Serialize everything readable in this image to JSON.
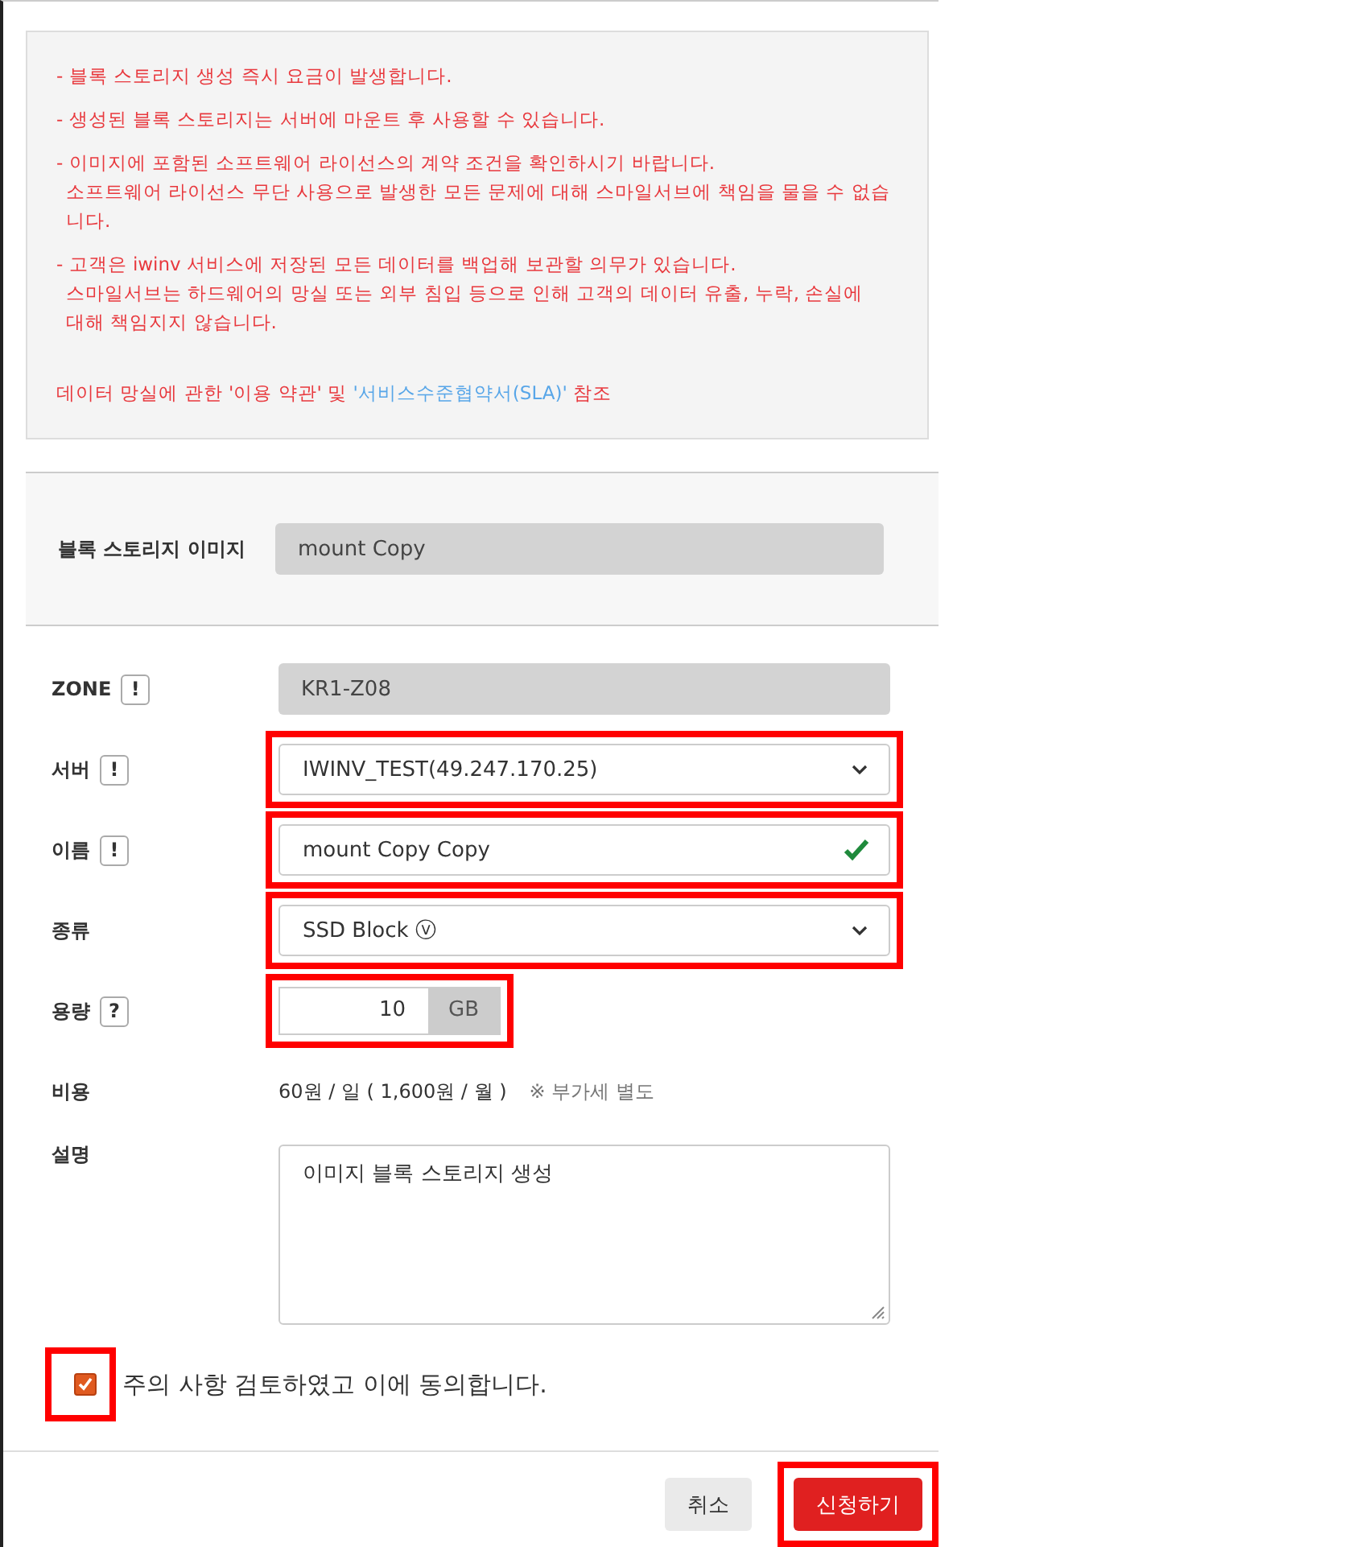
{
  "notice": {
    "paragraphs": [
      [
        "- 블록 스토리지 생성 즉시 요금이 발생합니다."
      ],
      [
        "- 생성된 블록 스토리지는 서버에 마운트 후 사용할 수 있습니다."
      ],
      [
        "- 이미지에 포함된 소프트웨어 라이선스의 계약 조건을 확인하시기 바랍니다.",
        "소프트웨어 라이선스 무단 사용으로 발생한 모든 문제에 대해 스마일서브에 책임을 물을 수 없습니다."
      ],
      [
        "- 고객은 iwinv 서비스에 저장된 모든 데이터를 백업해 보관할 의무가 있습니다.",
        "스마일서브는 하드웨어의 망실 또는 외부 침입 등으로 인해 고객의 데이터 유출, 누락, 손실에",
        "대해 책임지지 않습니다."
      ]
    ],
    "reference": {
      "before": "데이터 망실에 관한 '이용 약관' 및 ",
      "link": "'서비스수준협약서(SLA)'",
      "after": " 참조"
    }
  },
  "image": {
    "label": "블록 스토리지 이미지",
    "value": "mount Copy"
  },
  "fields": [
    {
      "kind": "readonly",
      "label": "ZONE",
      "hint": "!",
      "value": "KR1-Z08",
      "highlighted": false
    },
    {
      "kind": "select",
      "label": "서버",
      "hint": "!",
      "value": "IWINV_TEST(49.247.170.25)",
      "highlighted": true
    },
    {
      "kind": "text",
      "label": "이름",
      "hint": "!",
      "value": "mount Copy Copy",
      "valid": true,
      "highlighted": true
    },
    {
      "kind": "select",
      "label": "종류",
      "value": "SSD Block ⓥ",
      "highlighted": true
    },
    {
      "kind": "size",
      "label": "용량",
      "hint": "?",
      "value": "10",
      "unit": "GB",
      "highlighted": true
    },
    {
      "kind": "cost",
      "label": "비용",
      "value": "60원 / 일 ( 1,600원 / 월 )",
      "note": "※ 부가세 별도",
      "highlighted": false
    },
    {
      "kind": "textarea",
      "label": "설명",
      "value": "이미지 블록 스토리지 생성",
      "highlighted": false
    }
  ],
  "agree": {
    "label": "주의 사항 검토하였고 이에 동의합니다.",
    "checked": true,
    "highlighted": true
  },
  "buttons": [
    {
      "label": "취소",
      "kind": "secondary",
      "highlighted": false
    },
    {
      "label": "신청하기",
      "kind": "primary",
      "highlighted": true
    }
  ]
}
